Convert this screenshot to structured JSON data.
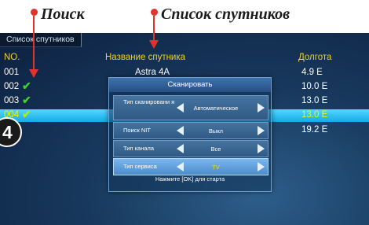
{
  "annotations": {
    "search_label": "Поиск",
    "list_label": "Список спутников",
    "dot_color": "#e2322c"
  },
  "tab": {
    "label": "Список спутников"
  },
  "table": {
    "headers": {
      "no": "NO.",
      "name": "Название спутника",
      "longitude": "Долгота"
    },
    "rows": [
      {
        "no": "001",
        "name": "Astra 4A",
        "longitude": "4.9 E",
        "checked": false
      },
      {
        "no": "002",
        "name": "",
        "longitude": "10.0 E",
        "checked": true
      },
      {
        "no": "003",
        "name": "",
        "longitude": "13.0 E",
        "checked": true
      },
      {
        "no": "004",
        "name": "",
        "longitude": "13.0 E",
        "checked": true,
        "selected": true
      },
      {
        "no": "005",
        "name": "",
        "longitude": "19.2 E",
        "checked": false
      }
    ]
  },
  "dialog": {
    "title": "Сканировать",
    "options": [
      {
        "label": "Тип сканировани я",
        "value": "Автоматическое"
      },
      {
        "label": "Поиск NIT",
        "value": "Выкл"
      },
      {
        "label": "Тип канала",
        "value": "Все"
      },
      {
        "label": "Тип сервиса",
        "value": "TV"
      }
    ],
    "footer": "Нажмите [OK] для старта"
  },
  "badge": {
    "number": "4"
  },
  "colors": {
    "header_yellow": "#f2d21b",
    "selected_row": "#16a8e8",
    "check_green": "#3dd12e",
    "arrow_red": "#e2322c"
  }
}
